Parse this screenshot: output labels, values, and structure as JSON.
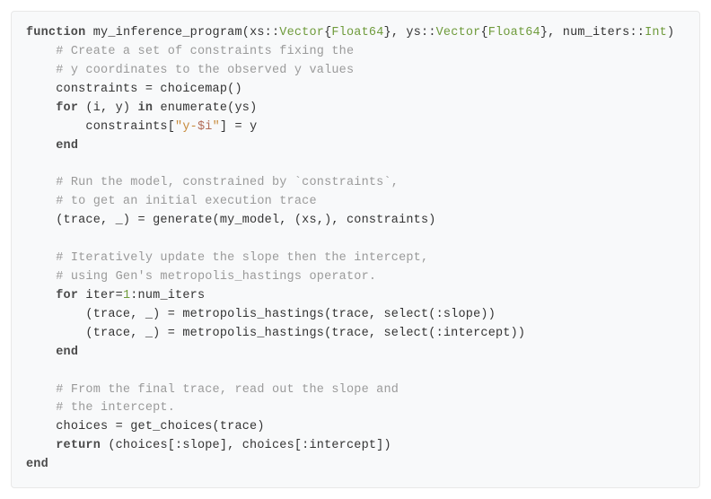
{
  "code": {
    "l01": {
      "kw1": "function",
      "fn": "my_inference_program",
      "p1": "(xs::",
      "ty1": "Vector",
      "p2": "{",
      "ty2": "Float64",
      "p3": "}, ys::",
      "ty3": "Vector",
      "p4": "{",
      "ty4": "Float64",
      "p5": "}, num_iters::",
      "ty5": "Int",
      "p6": ")"
    },
    "l02": {
      "cm": "# Create a set of constraints fixing the"
    },
    "l03": {
      "cm": "# y coordinates to the observed y values"
    },
    "l04": {
      "txt": "constraints = choicemap()"
    },
    "l05": {
      "kw1": "for",
      "txt1": " (i, y) ",
      "kw2": "in",
      "txt2": " enumerate(ys)"
    },
    "l06": {
      "txt1": "constraints[",
      "str1": "\"y-",
      "itp": "$i",
      "str2": "\"",
      "txt2": "] = y"
    },
    "l07": {
      "kw": "end"
    },
    "l08": {
      "cm": "# Run the model, constrained by `constraints`,"
    },
    "l09": {
      "cm": "# to get an initial execution trace"
    },
    "l10": {
      "txt": "(trace, _) = generate(my_model, (xs,), constraints)"
    },
    "l11": {
      "cm": "# Iteratively update the slope then the intercept,"
    },
    "l12": {
      "cm": "# using Gen's metropolis_hastings operator."
    },
    "l13": {
      "kw": "for",
      "txt1": " iter=",
      "n1": "1",
      "txt2": ":num_iters"
    },
    "l14": {
      "txt": "(trace, _) = metropolis_hastings(trace, select(:slope))"
    },
    "l15": {
      "txt": "(trace, _) = metropolis_hastings(trace, select(:intercept))"
    },
    "l16": {
      "kw": "end"
    },
    "l17": {
      "cm": "# From the final trace, read out the slope and"
    },
    "l18": {
      "cm": "# the intercept."
    },
    "l19": {
      "txt": "choices = get_choices(trace)"
    },
    "l20": {
      "kw": "return",
      "txt": " (choices[:slope], choices[:intercept])"
    },
    "l21": {
      "kw": "end"
    }
  }
}
